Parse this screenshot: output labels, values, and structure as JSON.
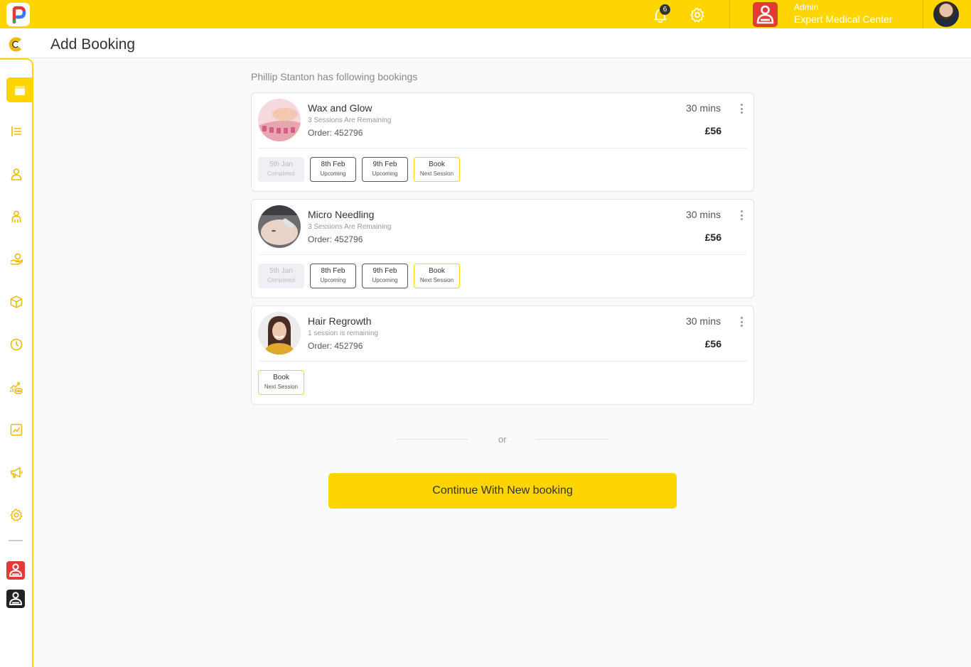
{
  "topbar": {
    "notification_count": "6",
    "role": "Admin",
    "center_name": "Expert Medical Center"
  },
  "header": {
    "title": "Add Booking"
  },
  "sidebar": {
    "items": [
      {
        "icon": "calendar-icon",
        "active": true
      },
      {
        "icon": "list-icon"
      },
      {
        "icon": "user-icon"
      },
      {
        "icon": "staff-icon"
      },
      {
        "icon": "services-icon"
      },
      {
        "icon": "box-icon"
      },
      {
        "icon": "clock-icon"
      },
      {
        "icon": "finance-icon"
      },
      {
        "icon": "chart-icon"
      },
      {
        "icon": "megaphone-icon"
      },
      {
        "icon": "gear-icon"
      }
    ]
  },
  "main": {
    "subtitle": "Phillip Stanton has following bookings",
    "bookings": [
      {
        "name": "Wax and Glow",
        "sessions": "3 Sessions Are Remaining",
        "order": "Order: 452796",
        "duration": "30 mins",
        "price": "£56",
        "chips": [
          {
            "date": "5th Jan",
            "status": "Completed",
            "kind": "done"
          },
          {
            "date": "8th Feb",
            "status": "Upcoming",
            "kind": "upcoming"
          },
          {
            "date": "9th Feb",
            "status": "Upcoming",
            "kind": "upcoming"
          },
          {
            "date": "Book",
            "status": "Next Session",
            "kind": "book"
          }
        ]
      },
      {
        "name": "Micro Needling",
        "sessions": "3 Sessions Are Remaining",
        "order": "Order: 452796",
        "duration": "30 mins",
        "price": "£56",
        "chips": [
          {
            "date": "5th Jan",
            "status": "Completed",
            "kind": "done"
          },
          {
            "date": "8th Feb",
            "status": "Upcoming",
            "kind": "upcoming"
          },
          {
            "date": "9th Feb",
            "status": "Upcoming",
            "kind": "upcoming"
          },
          {
            "date": "Book",
            "status": "Next Session",
            "kind": "book"
          }
        ]
      },
      {
        "name": "Hair Regrowth",
        "sessions": "1 session is remaining",
        "order": "Order: 452796",
        "duration": "30 mins",
        "price": "£56",
        "chips": [
          {
            "date": "Book",
            "status": "Next Session",
            "kind": "book"
          }
        ]
      }
    ],
    "or_text": "or",
    "cta_label": "Continue With New booking"
  },
  "colors": {
    "accent": "#ffd500",
    "brand_red": "#e53935"
  }
}
